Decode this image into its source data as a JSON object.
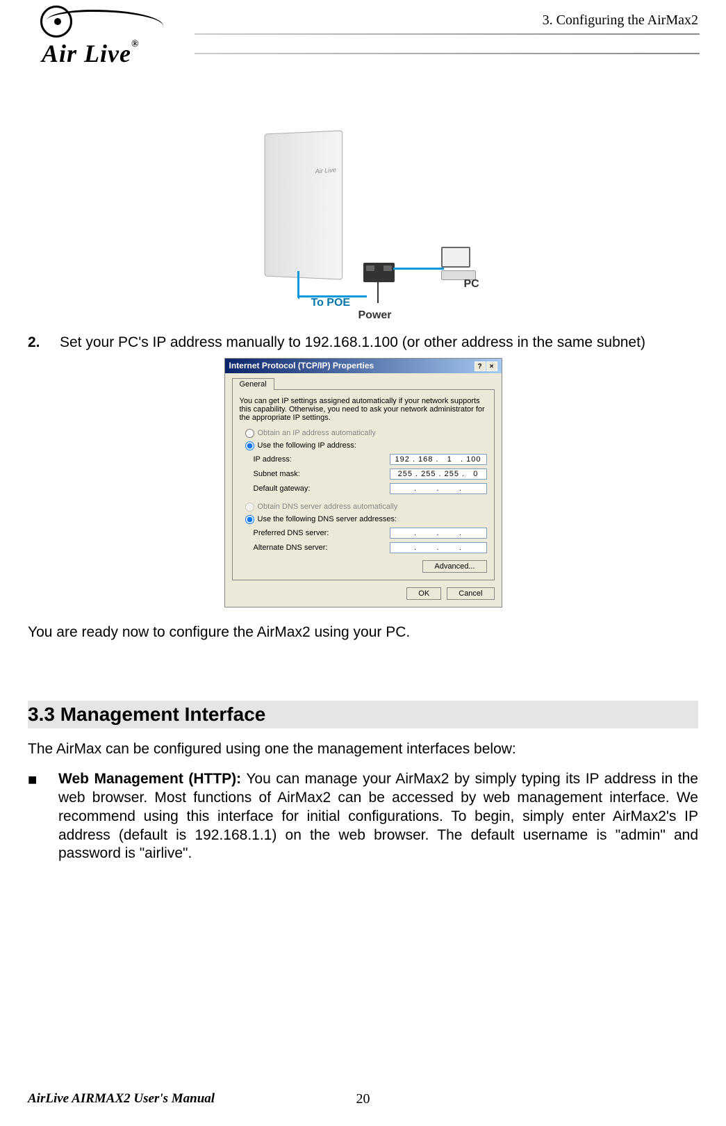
{
  "header": {
    "chapter": "3. Configuring the AirMax2",
    "logo_text": "Air Live",
    "logo_r": "®"
  },
  "diagram": {
    "airmax_badge": "Air Live",
    "to_poe": "To POE",
    "power": "Power",
    "pc": "PC"
  },
  "step2": {
    "num": "2.",
    "text": "Set your PC's IP address manually to 192.168.1.100 (or other address in the same subnet)"
  },
  "tcpip": {
    "title": "Internet Protocol (TCP/IP) Properties",
    "help": "?",
    "close": "×",
    "tab_general": "General",
    "intro": "You can get IP settings assigned automatically if your network supports this capability. Otherwise, you need to ask your network administrator for the appropriate IP settings.",
    "radio_auto_ip": "Obtain an IP address automatically",
    "radio_use_ip": "Use the following IP address:",
    "ip_label": "IP address:",
    "ip_value": "192 . 168 .   1   . 100",
    "mask_label": "Subnet mask:",
    "mask_value": "255 . 255 . 255 .   0",
    "gw_label": "Default gateway:",
    "gw_value": ".       .       .",
    "radio_auto_dns": "Obtain DNS server address automatically",
    "radio_use_dns": "Use the following DNS server addresses:",
    "pref_dns_label": "Preferred DNS server:",
    "pref_dns_value": ".       .       .",
    "alt_dns_label": "Alternate DNS server:",
    "alt_dns_value": ".       .       .",
    "advanced": "Advanced...",
    "ok": "OK",
    "cancel": "Cancel"
  },
  "ready_text": "You are ready now to configure the AirMax2 using your PC.",
  "section": {
    "heading": "3.3 Management  Interface",
    "intro": "The AirMax can be configured using one the management interfaces below:",
    "bullet_label": "Web Management (HTTP):",
    "bullet_body": "   You can manage your AirMax2 by simply typing its IP address in the web browser.   Most functions of AirMax2 can be accessed by web management interface.   We recommend using this interface for initial configurations.  To begin, simply enter AirMax2's IP address (default is 192.168.1.1) on the web browser.   The default username is \"admin\" and password is \"airlive\"."
  },
  "footer": {
    "manual": "AirLive AIRMAX2 User's Manual",
    "page": "20"
  }
}
